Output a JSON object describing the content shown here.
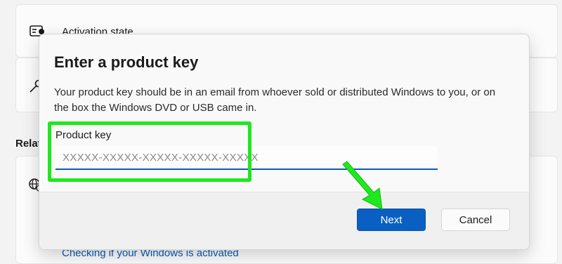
{
  "background": {
    "activation_state_label": "Activation state",
    "related_label": "Relat",
    "checking_link": "Checking if your Windows is activated"
  },
  "dialog": {
    "title": "Enter a product key",
    "description": "Your product key should be in an email from whoever sold or distributed Windows to you, or on the box the Windows DVD or USB came in.",
    "field_label": "Product key",
    "field_placeholder": "XXXXX-XXXXX-XXXXX-XXXXX-XXXXX",
    "field_value": "",
    "next_label": "Next",
    "cancel_label": "Cancel"
  },
  "colors": {
    "accent": "#0a5fc2",
    "highlight": "#1ee81e"
  },
  "icons": {
    "activation": "activation-state-icon",
    "key": "key-icon",
    "help": "help-globe-icon",
    "arrow": "annotation-arrow-icon"
  }
}
